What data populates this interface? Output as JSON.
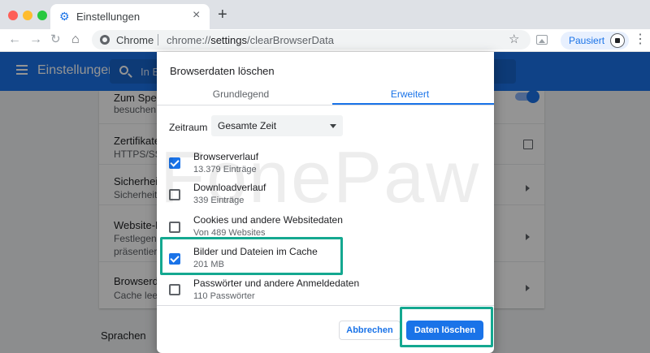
{
  "browser": {
    "tab_title": "Einstellungen",
    "omnibox_scheme": "Chrome",
    "url_prefix": "chrome://",
    "url_host": "settings",
    "url_path": "/clearBrowserData",
    "profile_status": "Pausiert"
  },
  "settings": {
    "header_title": "Einstellungen",
    "search_placeholder": "In E",
    "rows": [
      {
        "title": "Zum Speic",
        "sub": "besuchen"
      },
      {
        "title": "Zertifikate v",
        "sub": "HTTPS/SSL"
      },
      {
        "title": "Sicherheits",
        "sub": "Sicherheits"
      },
      {
        "title": "Website-Ein",
        "sub_lines": [
          "Festlegen, w",
          "präsentiere"
        ]
      },
      {
        "title": "Browserdat",
        "sub": "Cache leere"
      }
    ],
    "section_heading": "Sprachen"
  },
  "dialog": {
    "title": "Browserdaten löschen",
    "tabs": [
      {
        "label": "Grundlegend",
        "active": false
      },
      {
        "label": "Erweitert",
        "active": true
      }
    ],
    "time_range_label": "Zeitraum",
    "time_range_value": "Gesamte Zeit",
    "items": [
      {
        "title": "Browserverlauf",
        "sub": "13.379 Einträge",
        "checked": true
      },
      {
        "title": "Downloadverlauf",
        "sub": "339 Einträge",
        "checked": false
      },
      {
        "title": "Cookies und andere Websitedaten",
        "sub": "Von 489 Websites",
        "checked": false
      },
      {
        "title": "Bilder und Dateien im Cache",
        "sub": "201 MB",
        "checked": true
      },
      {
        "title": "Passwörter und andere Anmeldedaten",
        "sub": "110 Passwörter",
        "checked": false
      }
    ],
    "cancel_label": "Abbrechen",
    "confirm_label": "Daten löschen"
  },
  "watermark": "FonePaw",
  "colors": {
    "accent": "#1a73e8",
    "highlight": "#14a890"
  }
}
